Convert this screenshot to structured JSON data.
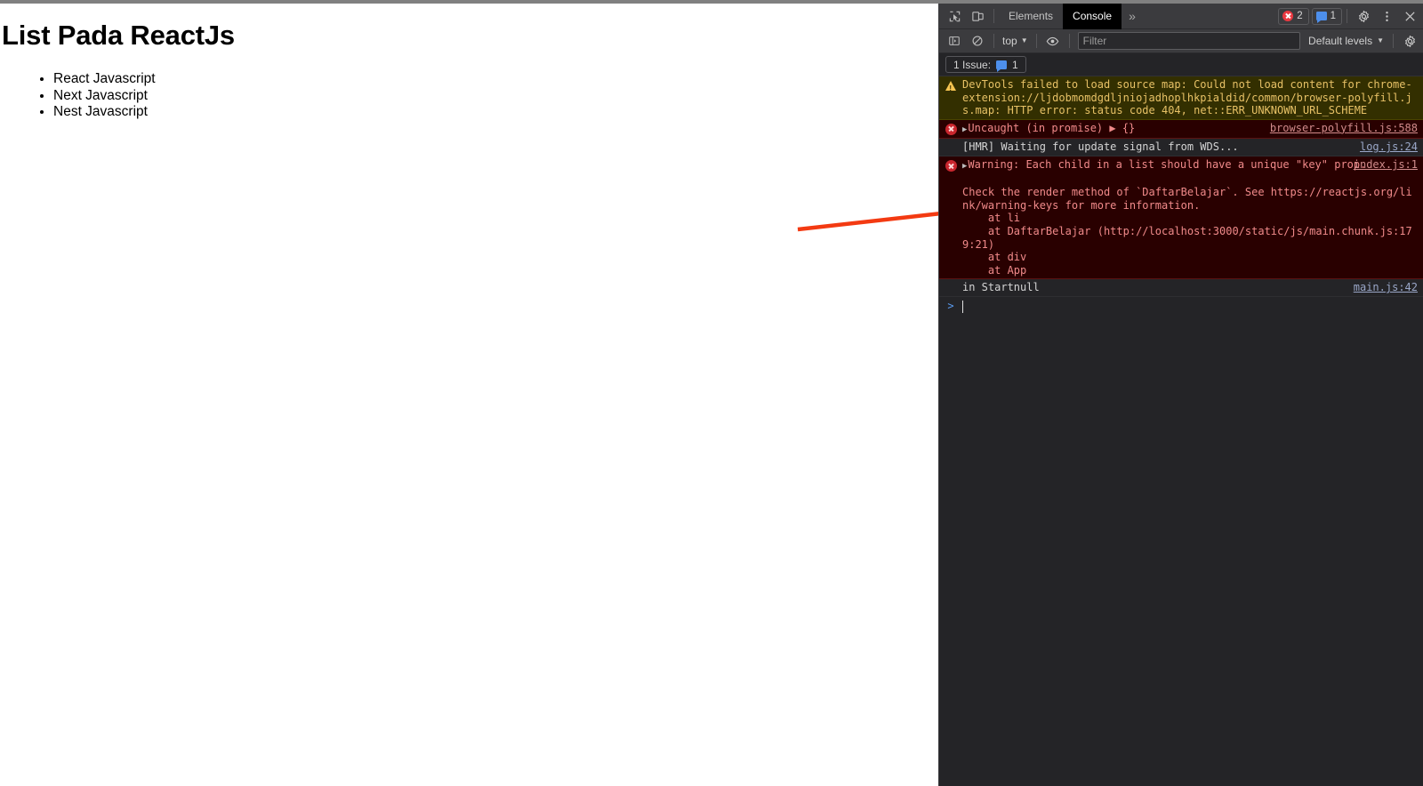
{
  "page": {
    "heading": "List Pada ReactJs",
    "list": [
      "React Javascript",
      "Next Javascript",
      "Nest Javascript"
    ]
  },
  "annotation": {
    "name": "red-arrow",
    "color": "#f33a12"
  },
  "devtools": {
    "toolbar": {
      "inspect_icon": "inspect-cursor-icon",
      "device_icon": "device-toolbar-icon",
      "tabs": [
        {
          "label": "Elements",
          "active": false
        },
        {
          "label": "Console",
          "active": true
        }
      ],
      "more_tabs_label": "»",
      "error_badge_count": "2",
      "message_badge_count": "1",
      "settings_icon": "gear-icon",
      "more_icon": "kebab-menu-icon",
      "close_icon": "close-icon"
    },
    "filterbar": {
      "sidebar_icon": "console-sidebar-icon",
      "clear_icon": "clear-console-icon",
      "context_label": "top",
      "eye_icon": "live-expression-eye-icon",
      "filter_placeholder": "Filter",
      "filter_value": "",
      "levels_label": "Default levels",
      "settings_icon": "console-settings-gear-icon"
    },
    "issues_bar": {
      "label": "1 Issue:",
      "icon": "issue-message-icon",
      "count": "1"
    },
    "messages": [
      {
        "level": "warning",
        "icon": "warning-triangle-icon",
        "expandable": false,
        "segments": [
          {
            "text": "DevTools failed to load source map: Could not load content for ",
            "link": false
          },
          {
            "text": "chrome-extension://ljdobmomdgdljniojadhoplhkpialdid/common/browser-polyfill.js.map",
            "link": true
          },
          {
            "text": ": HTTP error: status code 404, net::ERR_UNKNOWN_URL_SCHEME",
            "link": false
          }
        ],
        "source": ""
      },
      {
        "level": "error",
        "icon": "error-circle-icon",
        "expandable": true,
        "segments": [
          {
            "text": "Uncaught (in promise) ",
            "link": false
          },
          {
            "text": "▶ {}",
            "link": false
          }
        ],
        "source": "browser-polyfill.js:588"
      },
      {
        "level": "info",
        "icon": "",
        "expandable": false,
        "segments": [
          {
            "text": "[HMR] Waiting for update signal from WDS...",
            "link": false
          }
        ],
        "source": "log.js:24"
      },
      {
        "level": "error",
        "icon": "error-circle-icon",
        "expandable": true,
        "segments": [
          {
            "text": "Warning: Each child in a list should have a unique \"key\" prop.\n\nCheck the render method of `DaftarBelajar`. See ",
            "link": false
          },
          {
            "text": "https://reactjs.org/link/warning-keys",
            "link": true
          },
          {
            "text": " for more information.\n    at li\n    at DaftarBelajar (",
            "link": false
          },
          {
            "text": "http://localhost:3000/static/js/main.chunk.js:179:21",
            "link": true
          },
          {
            "text": ")\n    at div\n    at App",
            "link": false
          }
        ],
        "source": "index.js:1"
      },
      {
        "level": "info",
        "icon": "",
        "expandable": false,
        "segments": [
          {
            "text": "in Startnull",
            "link": true
          }
        ],
        "source": "main.js:42"
      }
    ],
    "prompt": {
      "caret": ">",
      "value": ""
    }
  }
}
